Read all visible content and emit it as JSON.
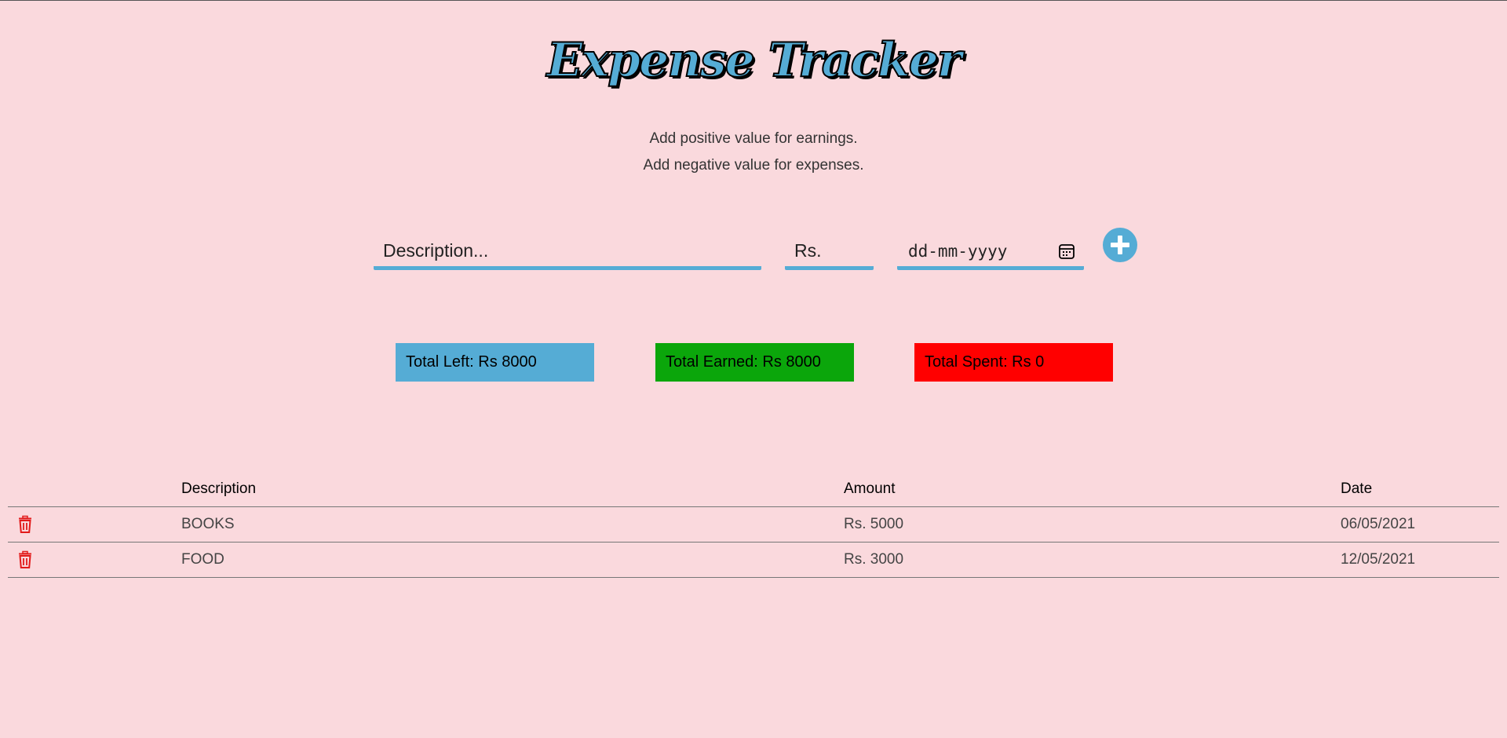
{
  "app": {
    "title": "Expense Tracker",
    "hints": [
      "Add positive value for earnings.",
      "Add negative value for expenses."
    ]
  },
  "form": {
    "description_placeholder": "Description...",
    "amount_placeholder": "Rs.",
    "date_placeholder": "dd-mm-yyyy",
    "add_icon": "plus-circle-icon",
    "calendar_icon": "calendar-icon"
  },
  "stats": {
    "left": "Total Left:  Rs  8000",
    "earned": "Total Earned:  Rs  8000",
    "spent": "Total Spent:  Rs  0"
  },
  "colors": {
    "accent": "#55acd5",
    "background": "#fad9dd",
    "earned": "#0ba60b",
    "spent": "#ff0000",
    "delete": "#e21b1b"
  },
  "table": {
    "headers": {
      "description": "Description",
      "amount": "Amount",
      "date": "Date"
    },
    "rows": [
      {
        "description": "BOOKS",
        "amount": "Rs. 5000",
        "date": "06/05/2021",
        "icon": "trash-icon"
      },
      {
        "description": "FOOD",
        "amount": "Rs. 3000",
        "date": "12/05/2021",
        "icon": "trash-icon"
      }
    ]
  }
}
